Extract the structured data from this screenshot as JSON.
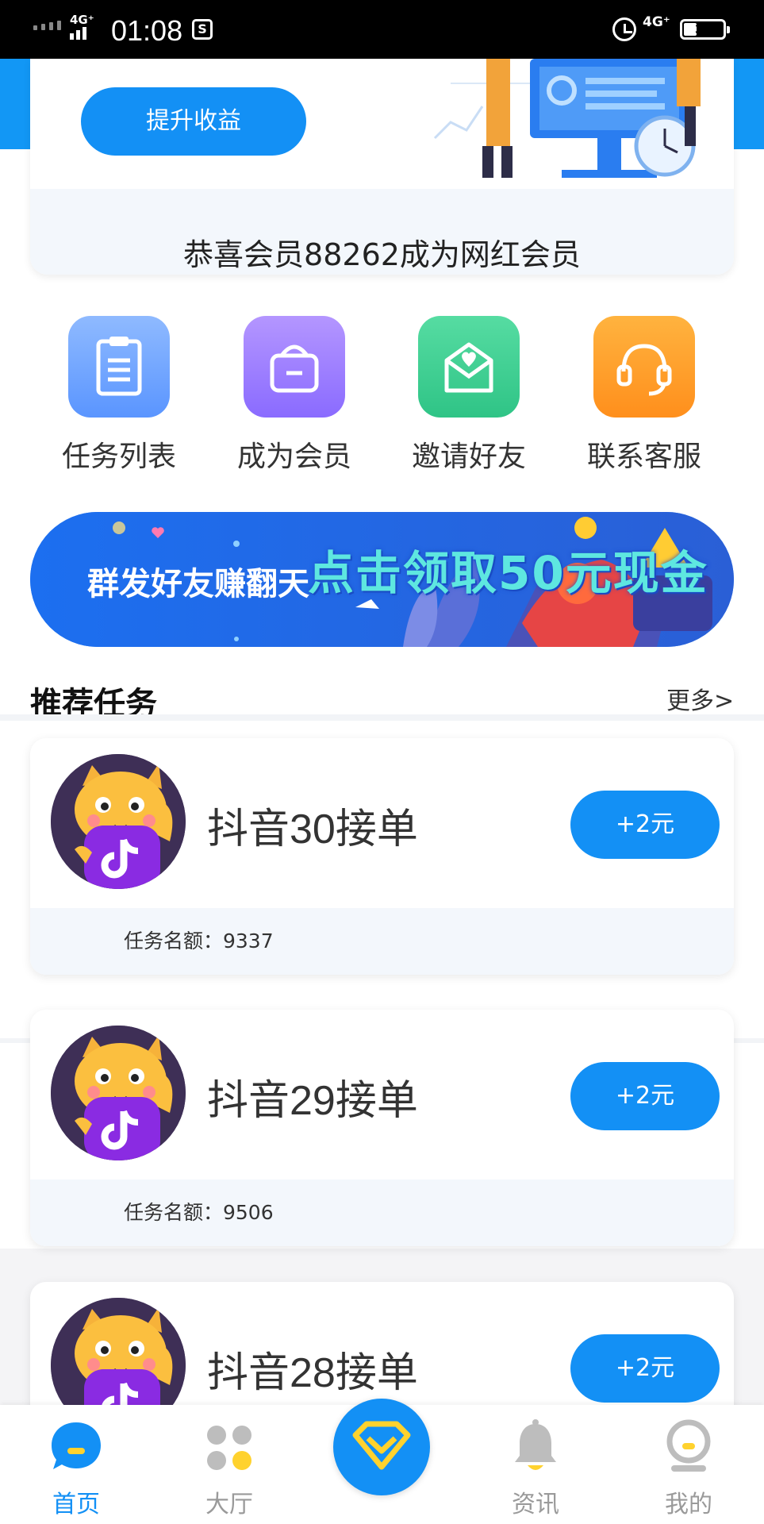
{
  "status_bar": {
    "network_left": "4G⁺",
    "time": "01:08",
    "network_right": "4G⁺",
    "battery": "34",
    "battery_level": 0.34
  },
  "top_card": {
    "upgrade_button": "提升收益",
    "notice": "恭喜会员88262成为网红会员"
  },
  "quick_actions": [
    {
      "label": "任务列表",
      "icon": "clipboard-icon",
      "color": "#6aa4ff"
    },
    {
      "label": "成为会员",
      "icon": "shopping-bag-icon",
      "color": "#9b7cff"
    },
    {
      "label": "邀请好友",
      "icon": "heart-envelope-icon",
      "color": "#3fcf94"
    },
    {
      "label": "联系客服",
      "icon": "headset-icon",
      "color": "#ffa127"
    }
  ],
  "banner": {
    "left_text": "群发好友赚翻天",
    "right_text": "点击领取50元现金"
  },
  "recommended": {
    "title": "推荐任务",
    "more": "更多>"
  },
  "tasks": [
    {
      "name": "抖音30接单",
      "reward": "+2元",
      "quota": "任务名额：9337"
    },
    {
      "name": "抖音29接单",
      "reward": "+2元",
      "quota": "任务名额：9506"
    },
    {
      "name": "抖音28接单",
      "reward": "+2元",
      "quota": ""
    }
  ],
  "bottom_nav": [
    {
      "label": "首页",
      "icon": "chat-bubble-icon",
      "active": true
    },
    {
      "label": "大厅",
      "icon": "dots-grid-icon",
      "active": false
    },
    {
      "label": "",
      "icon": "diamond-icon",
      "active": false
    },
    {
      "label": "资讯",
      "icon": "bell-icon",
      "active": false
    },
    {
      "label": "我的",
      "icon": "profile-icon",
      "active": false
    }
  ],
  "colors": {
    "primary": "#1390f5",
    "card_footer": "#f3f7fc"
  }
}
